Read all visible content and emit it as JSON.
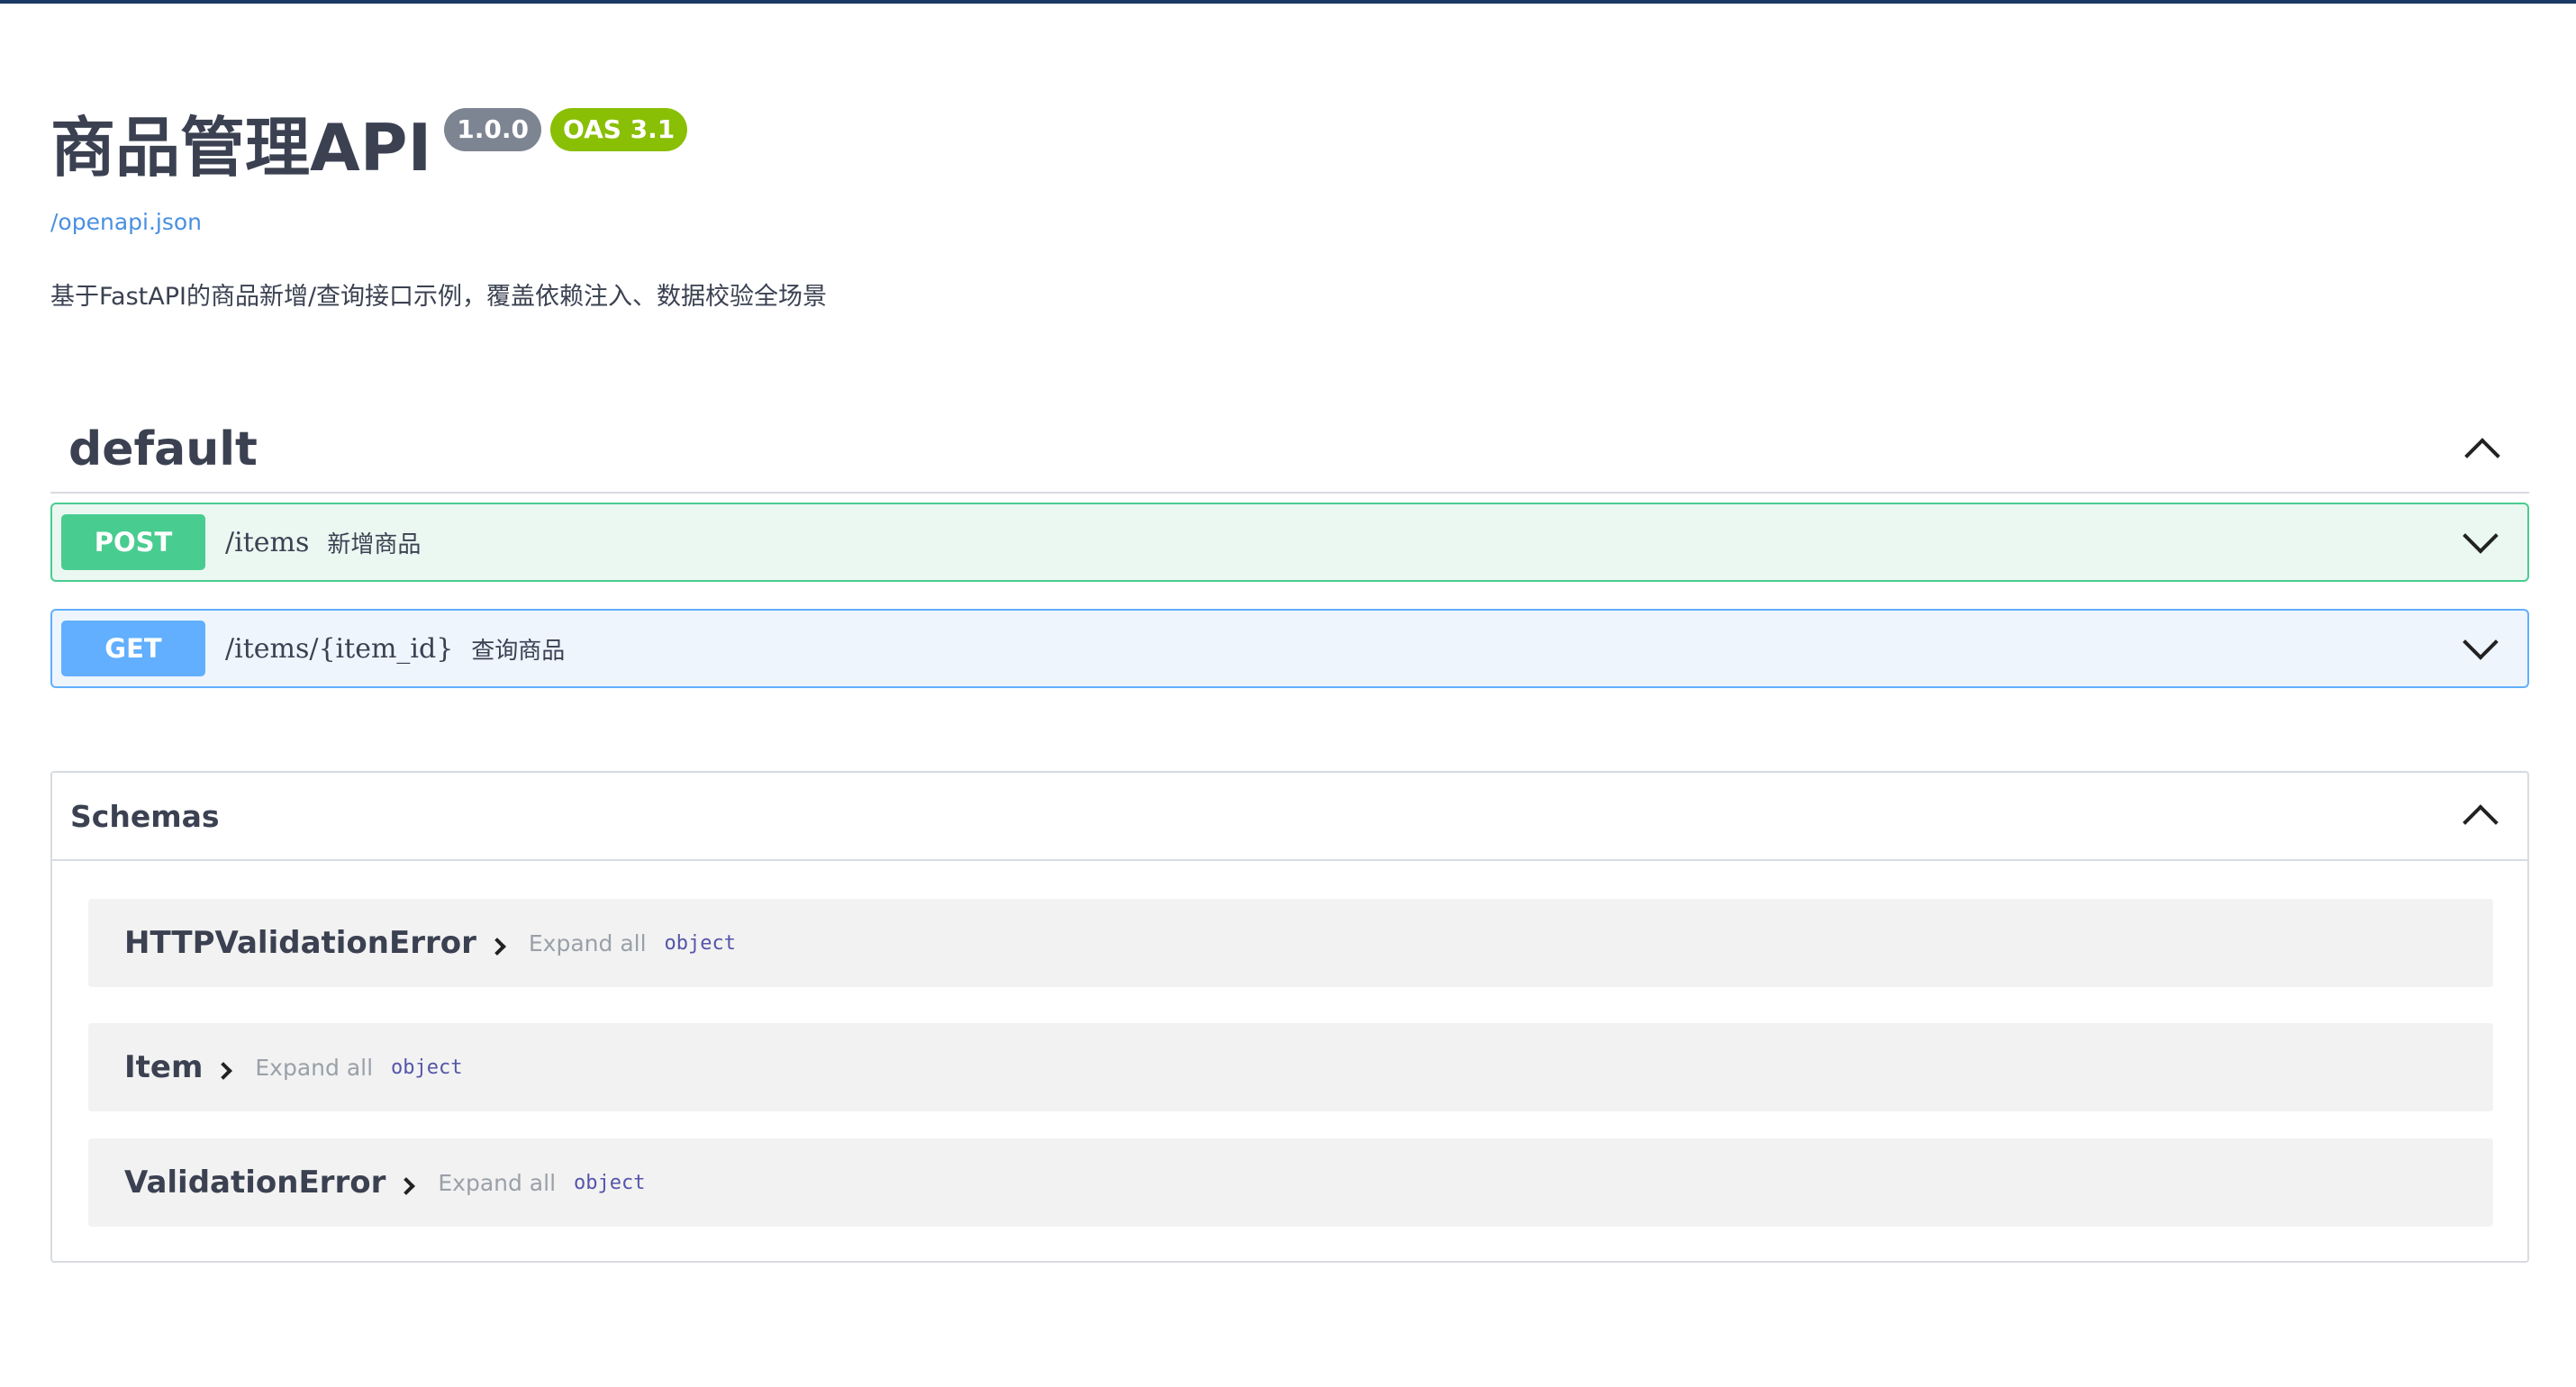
{
  "info": {
    "title": "商品管理API",
    "version": "1.0.0",
    "oas": "OAS 3.1",
    "spec_link": "/openapi.json",
    "description": "基于FastAPI的商品新增/查询接口示例，覆盖依赖注入、数据校验全场景"
  },
  "tag": {
    "name": "default",
    "operations": [
      {
        "method": "POST",
        "path": "/items",
        "summary": "新增商品",
        "color": "#49cc90"
      },
      {
        "method": "GET",
        "path": "/items/{item_id}",
        "summary": "查询商品",
        "color": "#61affe"
      }
    ]
  },
  "schemas": {
    "title": "Schemas",
    "models": [
      {
        "name": "HTTPValidationError",
        "expand_label": "Expand all",
        "type": "object"
      },
      {
        "name": "Item",
        "expand_label": "Expand all",
        "type": "object"
      },
      {
        "name": "ValidationError",
        "expand_label": "Expand all",
        "type": "object"
      }
    ]
  },
  "colors": {
    "accent_link": "#4990e2",
    "badge_version": "#7d8492",
    "badge_oas": "#89bf04",
    "top_border": "#1b3a63"
  }
}
